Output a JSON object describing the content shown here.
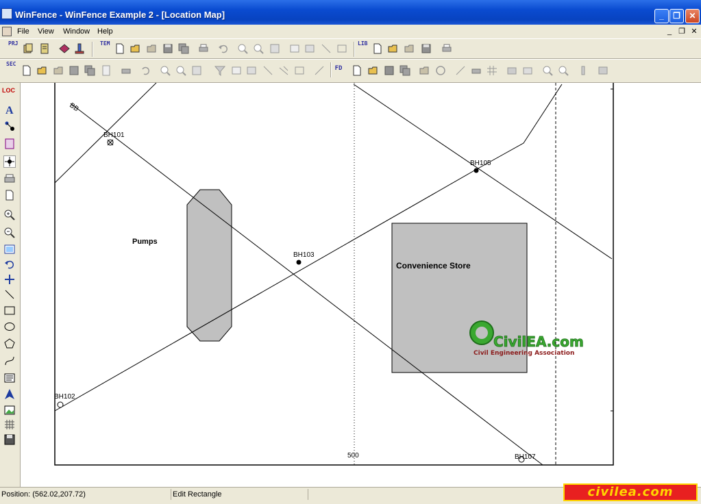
{
  "window": {
    "title": "WinFence - WinFence Example 2 - [Location Map]",
    "minimize": "_",
    "restore": "❐",
    "close": "✕"
  },
  "menu": {
    "items": [
      "File",
      "View",
      "Window",
      "Help"
    ],
    "mdi_minimize": "_",
    "mdi_restore": "❐",
    "mdi_close": "✕"
  },
  "toolbar1": {
    "prj_label": "PRJ",
    "tem_label": "TEM",
    "lib_label": "LIB"
  },
  "toolbar2": {
    "sec_label": "SEC",
    "fd_label": "FD"
  },
  "left_toolbar": {
    "loc_label": "LOC"
  },
  "map": {
    "labels": {
      "bb": "BB",
      "bh101": "BH101",
      "bh102": "BH102",
      "bh103": "BH103",
      "bh105": "BH105",
      "bh107": "BH107",
      "pumps": "Pumps",
      "store": "Convenience Store",
      "grid_500": "500"
    },
    "colors": {
      "area_fill": "#c0c0c0",
      "line": "#000000"
    }
  },
  "logo": {
    "name": "CivilEA.com",
    "tagline": "Civil Engineering Association"
  },
  "status": {
    "position": "Position: (562.02,207.72)",
    "mode": "Edit Rectangle"
  },
  "watermark": {
    "text": "civilea.com"
  }
}
